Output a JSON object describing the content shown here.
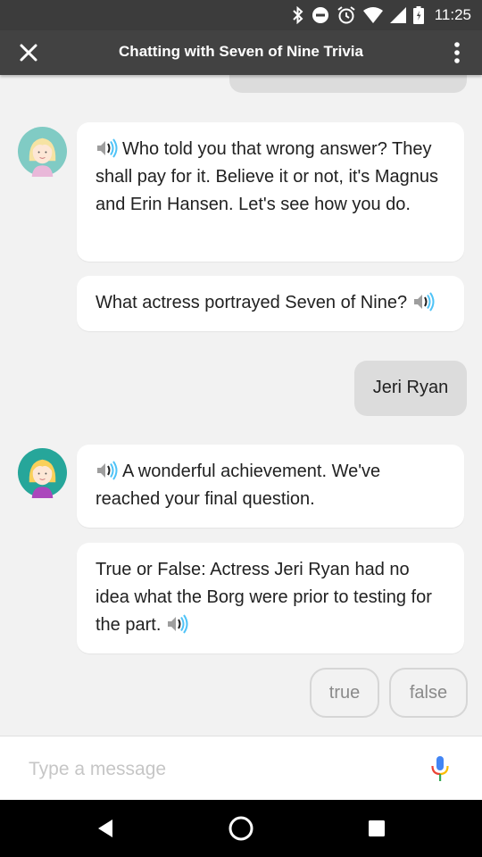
{
  "status_bar": {
    "time": "11:25",
    "icons": [
      "bluetooth-icon",
      "do-not-disturb-icon",
      "alarm-icon",
      "wifi-icon",
      "signal-icon",
      "battery-icon"
    ]
  },
  "app_bar": {
    "title": "Chatting with Seven of Nine Trivia",
    "close_icon": "close-icon",
    "menu_icon": "more-vert-icon"
  },
  "messages": {
    "agent_1": "Who told you that wrong answer? They shall pay for it. Believe it or not, it's Magnus and Erin Hansen. Let's see how you do.",
    "agent_2": "What actress portrayed Seven of Nine?",
    "user_1": "Jeri Ryan",
    "agent_3": "A wonderful achievement. We've reached your final question.",
    "agent_4": "True or False: Actress Jeri Ryan had no idea what the Borg were prior to testing for the part."
  },
  "suggestions": [
    "true",
    "false"
  ],
  "input": {
    "placeholder": "Type a message",
    "value": ""
  },
  "colors": {
    "status_bar": "#3c3c3c",
    "app_bar": "#424242",
    "background": "#f2f2f2",
    "agent_bubble": "#ffffff",
    "user_bubble": "#dcdcdc",
    "speaker_accent": "#4fc3f7"
  }
}
